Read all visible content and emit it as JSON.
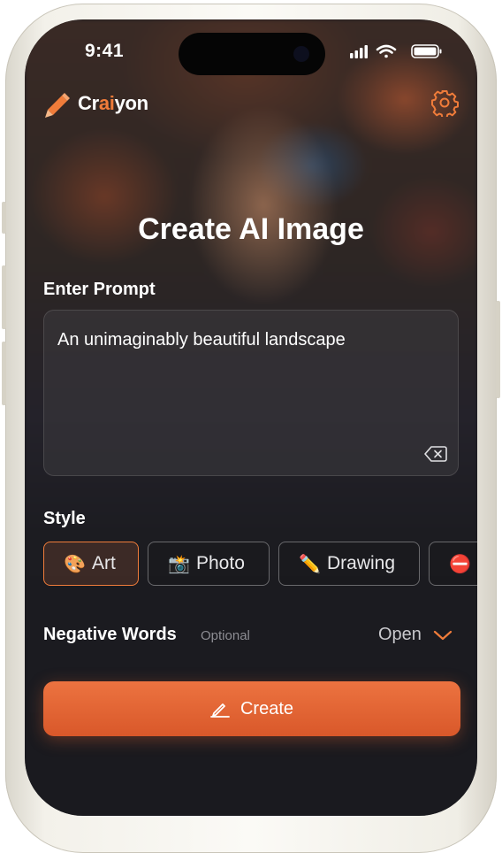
{
  "status": {
    "time": "9:41"
  },
  "app": {
    "name_prefix": "Cr",
    "name_highlight": "ai",
    "name_suffix": "yon",
    "accent_color": "#f07c3a"
  },
  "header": {
    "settings_icon": "gear-icon"
  },
  "main": {
    "title": "Create AI Image",
    "prompt_label": "Enter Prompt",
    "prompt_value": "An unimaginably beautiful landscape",
    "clear_icon": "backspace-icon",
    "style_label": "Style",
    "styles": [
      {
        "label": "Art",
        "emoji": "🎨",
        "active": true
      },
      {
        "label": "Photo",
        "emoji": "📸",
        "active": false
      },
      {
        "label": "Drawing",
        "emoji": "✏️",
        "active": false
      },
      {
        "label": "",
        "emoji": "⛔",
        "active": false
      }
    ],
    "negative_label": "Negative Words",
    "negative_optional": "Optional",
    "negative_toggle": "Open",
    "create_label": "Create"
  }
}
